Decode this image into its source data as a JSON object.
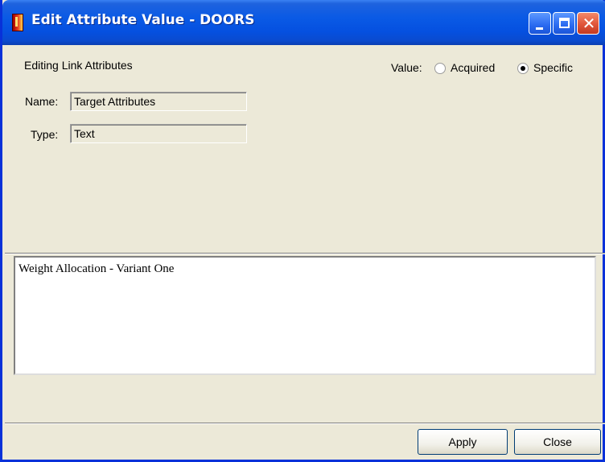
{
  "window": {
    "title": "Edit Attribute Value - DOORS"
  },
  "header": {
    "editing_label": "Editing Link Attributes",
    "value_label": "Value:",
    "value_options": [
      {
        "label": "Acquired",
        "selected": false
      },
      {
        "label": "Specific",
        "selected": true
      }
    ]
  },
  "fields": {
    "name_label": "Name:",
    "name_value": "Target Attributes",
    "type_label": "Type:",
    "type_value": "Text"
  },
  "editor": {
    "text": "Weight Allocation - Variant One"
  },
  "buttons": {
    "apply": "Apply",
    "close": "Close"
  },
  "colors": {
    "titlebar": "#0A5AE5",
    "dialog_bg": "#ECE9D8",
    "close_button": "#E0553A"
  },
  "icons": {
    "app": "doors-app-icon",
    "minimize": "minimize-icon",
    "maximize": "maximize-icon",
    "close": "close-icon"
  }
}
